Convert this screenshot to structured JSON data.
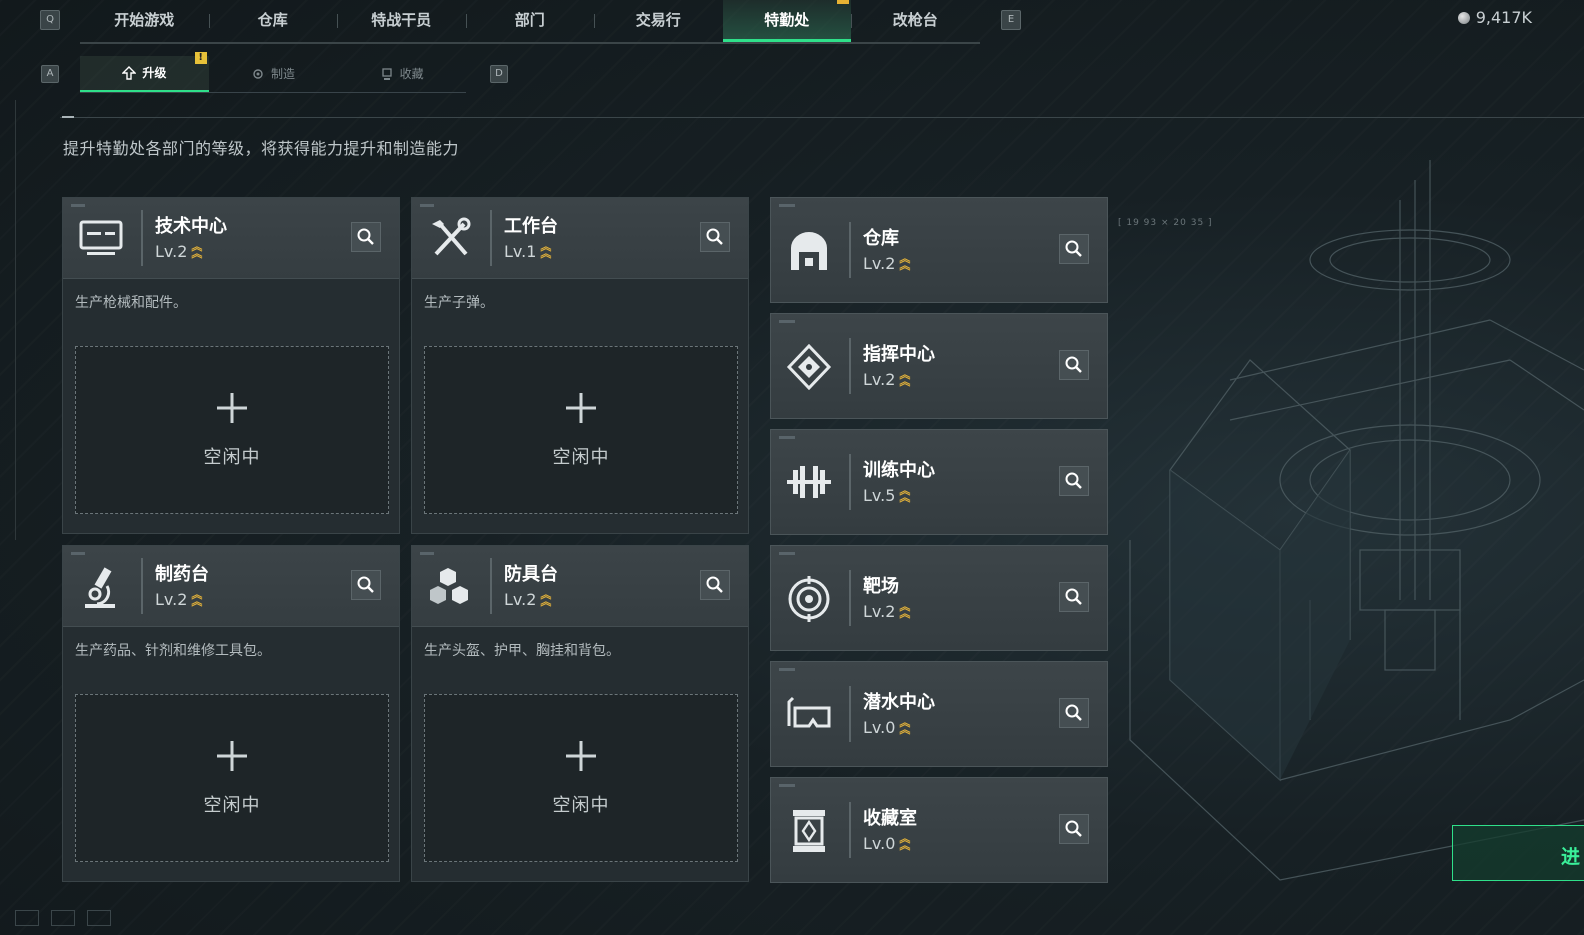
{
  "top_nav": {
    "left_key": "Q",
    "right_key": "E",
    "tabs": [
      {
        "label": "开始游戏"
      },
      {
        "label": "仓库"
      },
      {
        "label": "特战干员"
      },
      {
        "label": "部门"
      },
      {
        "label": "交易行"
      },
      {
        "label": "特勤处",
        "active": true
      },
      {
        "label": "改枪台"
      }
    ],
    "currency": "9,417K"
  },
  "sub_nav": {
    "left_key": "A",
    "right_key": "D",
    "tabs": [
      {
        "label": "升级",
        "active": true
      },
      {
        "label": "制造"
      },
      {
        "label": "收藏"
      }
    ],
    "warning_mark": "!"
  },
  "description": "提升特勤处各部门的等级，将获得能力提升和制造能力",
  "big_cards": [
    {
      "name": "技术中心",
      "level": "Lv.2",
      "desc": "生产枪械和配件。",
      "slot_status": "空闲中",
      "icon": "computer-icon"
    },
    {
      "name": "工作台",
      "level": "Lv.1",
      "desc": "生产子弹。",
      "slot_status": "空闲中",
      "icon": "tools-icon"
    },
    {
      "name": "制药台",
      "level": "Lv.2",
      "desc": "生产药品、针剂和维修工具包。",
      "slot_status": "空闲中",
      "icon": "microscope-icon"
    },
    {
      "name": "防具台",
      "level": "Lv.2",
      "desc": "生产头盔、护甲、胸挂和背包。",
      "slot_status": "空闲中",
      "icon": "boxes-icon"
    }
  ],
  "small_cards": [
    {
      "name": "仓库",
      "level": "Lv.2",
      "icon": "warehouse-icon"
    },
    {
      "name": "指挥中心",
      "level": "Lv.2",
      "icon": "command-icon"
    },
    {
      "name": "训练中心",
      "level": "Lv.5",
      "icon": "dumbbell-icon"
    },
    {
      "name": "靶场",
      "level": "Lv.2",
      "icon": "target-icon"
    },
    {
      "name": "潜水中心",
      "level": "Lv.0",
      "icon": "diving-mask-icon"
    },
    {
      "name": "收藏室",
      "level": "Lv.0",
      "icon": "collection-icon"
    }
  ],
  "scene": {
    "coordinate": "[ 19 93 × 20 35 ]"
  },
  "enter_button": "进",
  "colors": {
    "accent": "#2fe08a",
    "warning": "#e7b233",
    "level_chevron": "#e3b23a"
  }
}
